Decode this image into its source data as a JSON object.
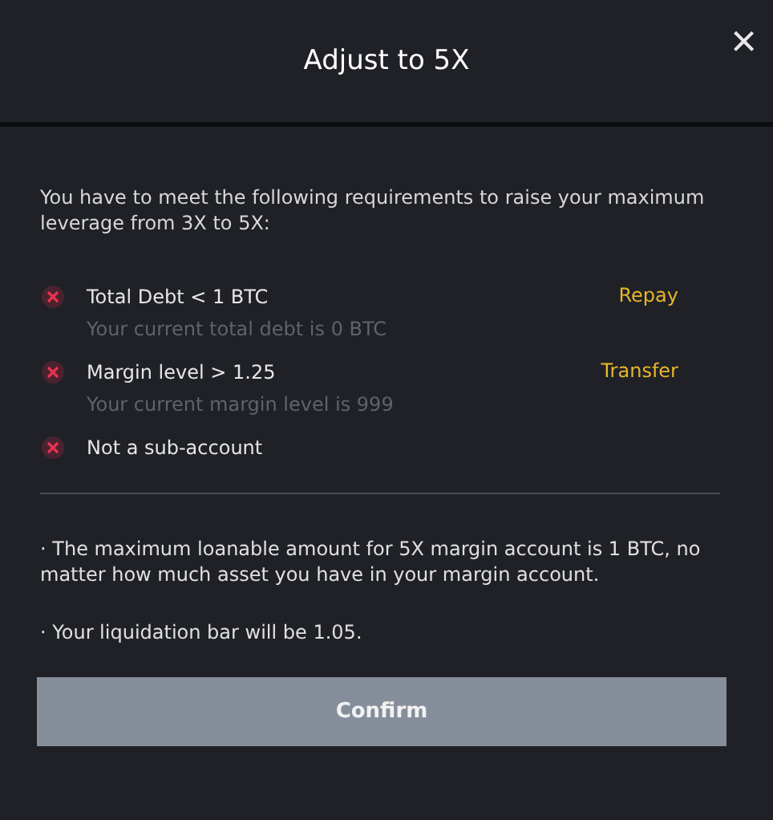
{
  "dialog": {
    "title": "Adjust to 5X",
    "close_label": "×"
  },
  "intro": "You have to meet the following requirements to raise your maximum leverage from 3X to 5X:",
  "requirements": [
    {
      "label": "Total Debt < 1 BTC",
      "detail": "Your current total debt is 0 BTC",
      "action": "Repay",
      "met": false
    },
    {
      "label": "Margin level > 1.25",
      "detail": "Your current margin level is 999",
      "action": "Transfer",
      "met": false
    },
    {
      "label": "Not a sub-account",
      "met": false
    }
  ],
  "notes": [
    "· The maximum loanable amount for 5X margin account is 1 BTC, no matter how much asset you have in your margin account.",
    "· Your liquidation bar will be 1.05."
  ],
  "confirm": {
    "label": "Confirm",
    "disabled": true
  }
}
